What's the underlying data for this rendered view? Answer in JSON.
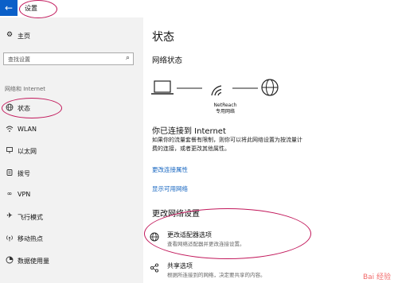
{
  "window": {
    "title": "设置"
  },
  "sidebar": {
    "home_label": "主页",
    "search_placeholder": "查找设置",
    "section_label": "网络和 Internet",
    "items": [
      {
        "label": "状态",
        "icon": "globe-icon"
      },
      {
        "label": "WLAN",
        "icon": "wifi-icon"
      },
      {
        "label": "以太网",
        "icon": "ethernet-icon"
      },
      {
        "label": "拨号",
        "icon": "dialup-icon"
      },
      {
        "label": "VPN",
        "icon": "vpn-icon"
      },
      {
        "label": "飞行模式",
        "icon": "airplane-icon"
      },
      {
        "label": "移动热点",
        "icon": "hotspot-icon"
      },
      {
        "label": "数据使用量",
        "icon": "data-usage-icon"
      }
    ]
  },
  "main": {
    "title": "状态",
    "network_status_heading": "网络状态",
    "network_name": "NetReach",
    "network_type": "专用网络",
    "connected_heading": "你已连接到 Internet",
    "connected_desc": "如果你的流量套餐有限制，则你可以将此网络设置为按流量计费的连接，或者更改其他属性。",
    "link_change_props": "更改连接属性",
    "link_show_networks": "显示可用网络",
    "change_settings_heading": "更改网络设置",
    "options": [
      {
        "label": "更改适配器选项",
        "sub": "查看网络适配器并更改连接设置。"
      },
      {
        "label": "共享选项",
        "sub": "根据所连接到的网络，决定要共享的内容。"
      }
    ]
  },
  "watermark": "Bai 经验",
  "colors": {
    "accent": "#0a5fc8",
    "annotation": "#c2185b",
    "link": "#1565c0"
  }
}
